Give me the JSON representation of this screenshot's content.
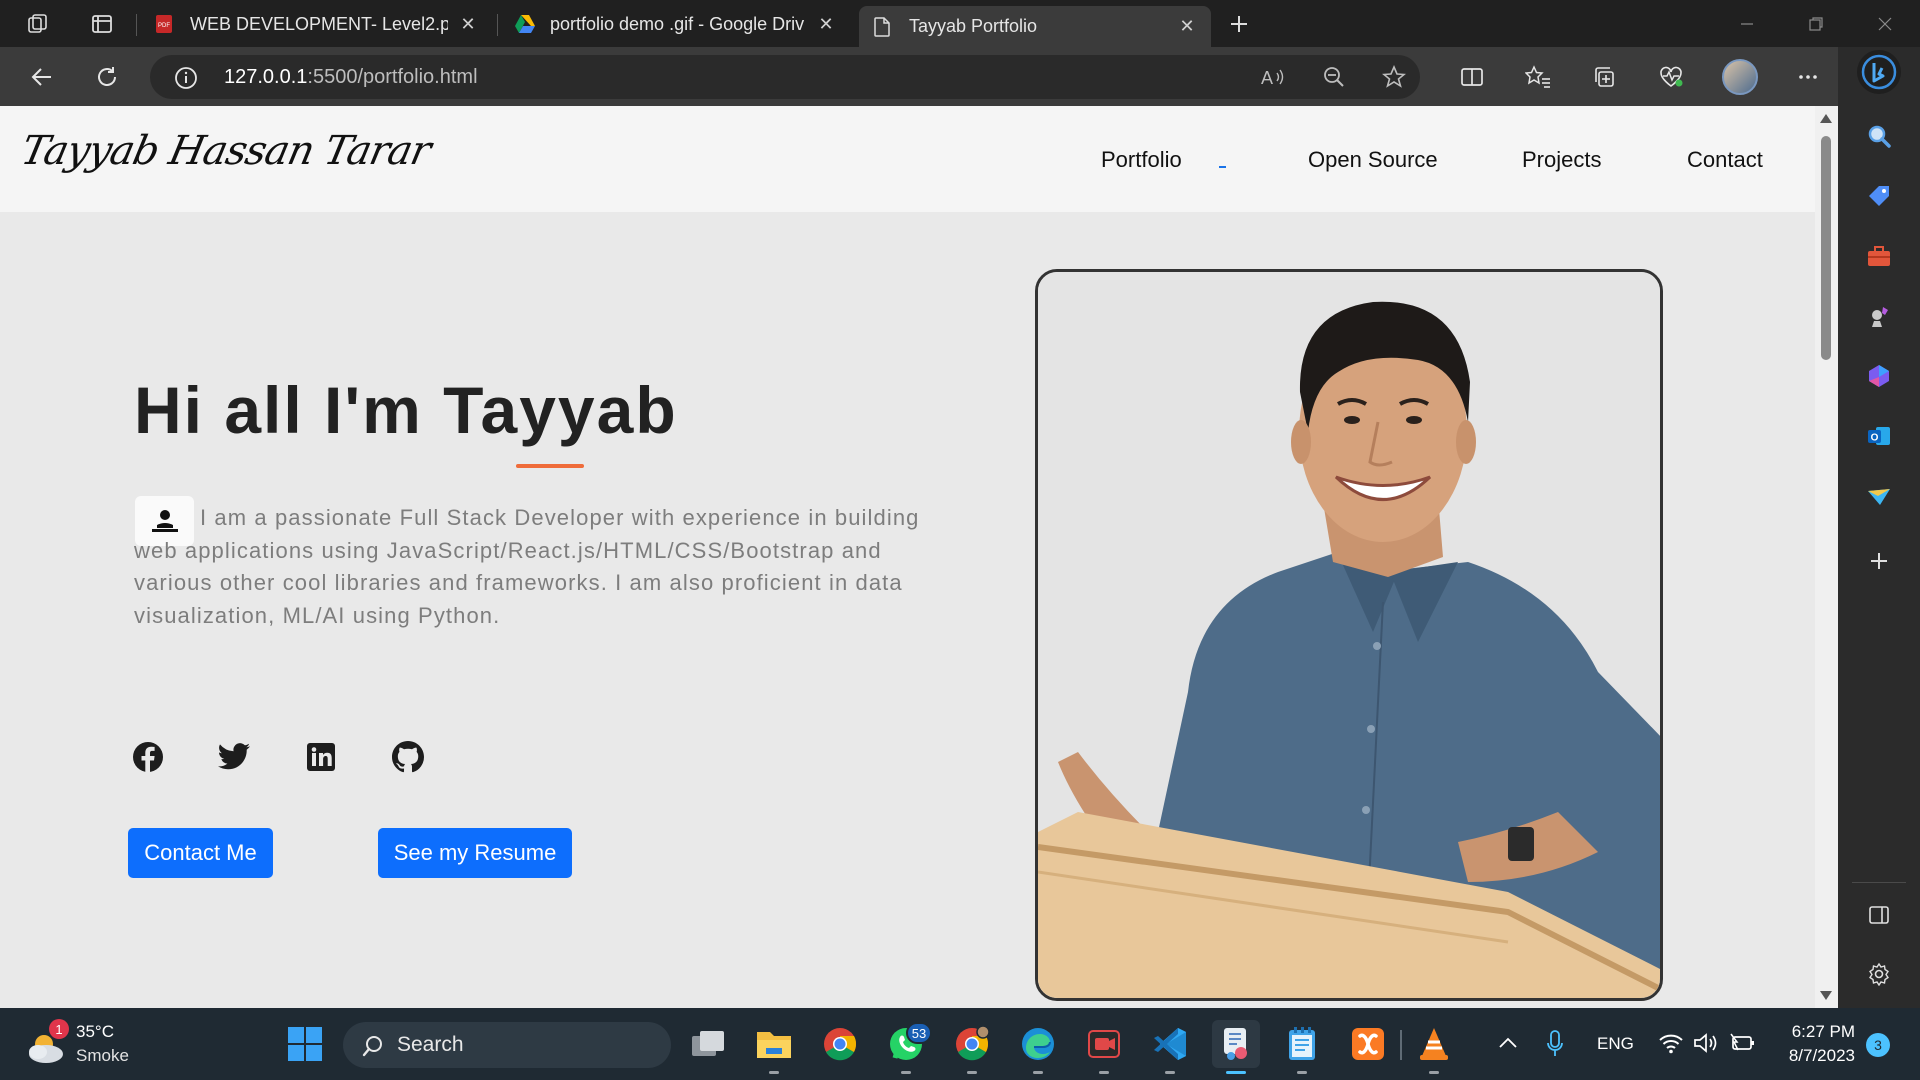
{
  "browser": {
    "tabs": [
      {
        "title": "WEB DEVELOPMENT- Level2.pdf",
        "icon": "pdf-icon",
        "active": false
      },
      {
        "title": "portfolio demo .gif - Google Driv",
        "icon": "google-drive-icon",
        "active": false
      },
      {
        "title": "Tayyab Portfolio",
        "icon": "page-icon",
        "active": true
      }
    ],
    "url_host": "127.0.0.1",
    "url_path": ":5500/portfolio.html"
  },
  "site": {
    "logo": "Tayyab Hassan Tarar",
    "nav": [
      "Portfolio",
      "Open Source",
      "Projects",
      "Contact"
    ],
    "greeting": "Hi all I'm Tayyab",
    "bio": "I am a passionate Full Stack Developer with experience in building web applications using JavaScript/React.js/HTML/CSS/Bootstrap and various other cool libraries and frameworks. I am also proficient in data visualization, ML/AI using Python.",
    "social": [
      "facebook-icon",
      "twitter-icon",
      "linkedin-icon",
      "github-icon"
    ],
    "buttons": {
      "contact": "Contact Me",
      "resume": "See my Resume"
    },
    "accent": "#0d6efd",
    "underline_color": "#ef6c3a"
  },
  "taskbar": {
    "weather_temp": "35°C",
    "weather_desc": "Smoke",
    "weather_badge": "1",
    "search_label": "Search",
    "whatsapp_badge": "53",
    "language": "ENG",
    "time": "6:27 PM",
    "date": "8/7/2023",
    "notification_count": "3"
  }
}
